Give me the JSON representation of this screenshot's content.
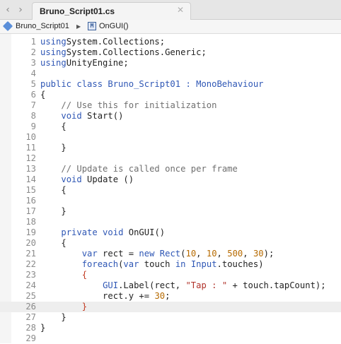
{
  "tab_bar": {
    "back_icon": "chevron-left-icon",
    "forward_icon": "chevron-right-icon",
    "tab_label": "Bruno_Script01.cs",
    "close_icon": "close-icon"
  },
  "jump_bar": {
    "file_label": "Bruno_Script01",
    "method_label": "OnGUI()",
    "method_icon_glyph": "M",
    "separator_icon": "triangle-right-icon"
  },
  "editor": {
    "current_line": 26,
    "colors": {
      "keyword": "#2f57b5",
      "comment": "#6f6f6f",
      "string": "#b0322a",
      "number": "#b66a00",
      "brace_highlight": "#c23b22"
    },
    "lines": [
      [
        [
          "kw",
          "using"
        ],
        [
          "",
          "System.Collections;"
        ]
      ],
      [
        [
          "kw",
          "using"
        ],
        [
          "",
          "System.Collections.Generic;"
        ]
      ],
      [
        [
          "kw",
          "using"
        ],
        [
          "",
          "UnityEngine;"
        ]
      ],
      [],
      [
        [
          "kw",
          "public class Bruno_Script01 : MonoBehaviour"
        ]
      ],
      [
        [
          "",
          "{"
        ]
      ],
      [
        [
          "",
          "    "
        ],
        [
          "cm",
          "// Use this for initialization"
        ]
      ],
      [
        [
          "",
          "    "
        ],
        [
          "kw",
          "void"
        ],
        [
          "",
          " Start()"
        ]
      ],
      [
        [
          "",
          "    {"
        ]
      ],
      [],
      [
        [
          "",
          "    }"
        ]
      ],
      [],
      [
        [
          "",
          "    "
        ],
        [
          "cm",
          "// Update is called once per frame"
        ]
      ],
      [
        [
          "",
          "    "
        ],
        [
          "kw",
          "void"
        ],
        [
          "",
          " Update ()"
        ]
      ],
      [
        [
          "",
          "    {"
        ]
      ],
      [],
      [
        [
          "",
          "    }"
        ]
      ],
      [],
      [
        [
          "",
          "    "
        ],
        [
          "kw",
          "private void"
        ],
        [
          "",
          " OnGUI()"
        ]
      ],
      [
        [
          "",
          "    {"
        ]
      ],
      [
        [
          "",
          "        "
        ],
        [
          "kw",
          "var"
        ],
        [
          "",
          " rect = "
        ],
        [
          "kw",
          "new"
        ],
        [
          "",
          " "
        ],
        [
          "kw",
          "Rect"
        ],
        [
          "",
          "("
        ],
        [
          "nm",
          "10"
        ],
        [
          "",
          ", "
        ],
        [
          "nm",
          "10"
        ],
        [
          "",
          ", "
        ],
        [
          "nm",
          "500"
        ],
        [
          "",
          ", "
        ],
        [
          "nm",
          "30"
        ],
        [
          "",
          ");"
        ]
      ],
      [
        [
          "",
          "        "
        ],
        [
          "kw",
          "foreach"
        ],
        [
          "",
          "("
        ],
        [
          "kw",
          "var"
        ],
        [
          "",
          " touch "
        ],
        [
          "kw",
          "in"
        ],
        [
          "",
          " "
        ],
        [
          "kw",
          "Input"
        ],
        [
          "",
          ".touches)"
        ]
      ],
      [
        [
          "",
          "        "
        ],
        [
          "br",
          "{"
        ]
      ],
      [
        [
          "",
          "            "
        ],
        [
          "kw",
          "GUI"
        ],
        [
          "",
          ".Label(rect, "
        ],
        [
          "st",
          "\"Tap : \""
        ],
        [
          "",
          " + touch.tapCount);"
        ]
      ],
      [
        [
          "",
          "            rect.y += "
        ],
        [
          "nm",
          "30"
        ],
        [
          "",
          ";"
        ]
      ],
      [
        [
          "",
          "        "
        ],
        [
          "br",
          "}"
        ]
      ],
      [
        [
          "",
          "    }"
        ]
      ],
      [
        [
          "",
          "}"
        ]
      ],
      []
    ]
  }
}
